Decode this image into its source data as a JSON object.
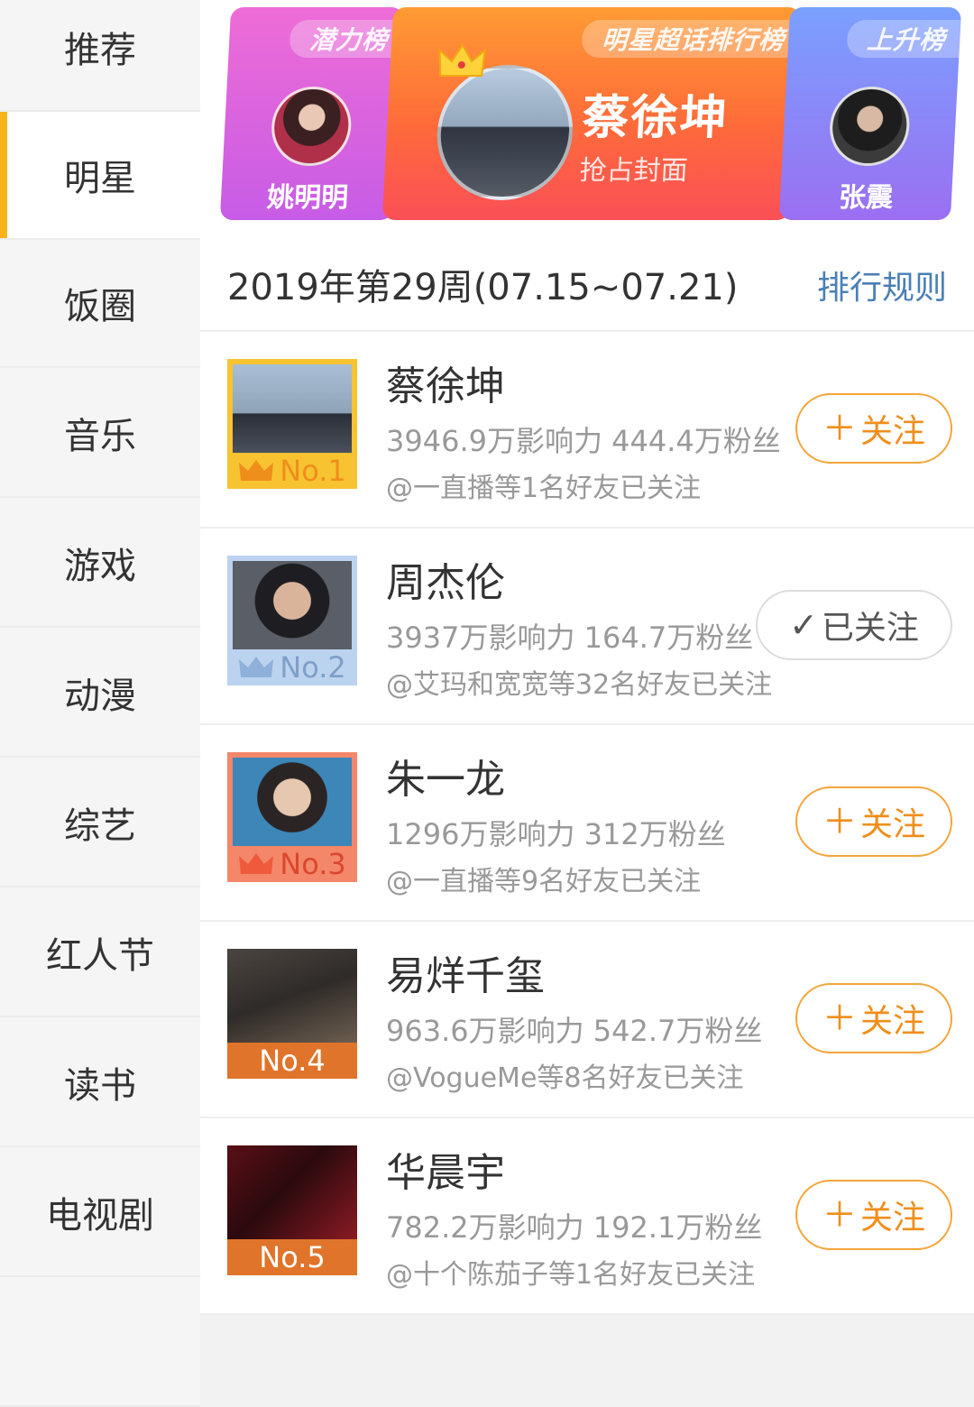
{
  "sidebar": {
    "items": [
      {
        "label": "推荐"
      },
      {
        "label": "明星"
      },
      {
        "label": "饭圈"
      },
      {
        "label": "音乐"
      },
      {
        "label": "游戏"
      },
      {
        "label": "动漫"
      },
      {
        "label": "综艺"
      },
      {
        "label": "红人节"
      },
      {
        "label": "读书"
      },
      {
        "label": "电视剧"
      }
    ],
    "active_index": 1,
    "active_color": "#f7b21c"
  },
  "banner": {
    "left": {
      "tag": "潜力榜",
      "name": "姚明明",
      "icon": "avatar"
    },
    "center": {
      "tag": "明星超话排行榜",
      "name": "蔡徐坤",
      "subtitle": "抢占封面",
      "icon": "crown-icon"
    },
    "right": {
      "tag": "上升榜",
      "name": "张震",
      "icon": "avatar"
    }
  },
  "week": {
    "title": "2019年第29周(07.15~07.21)",
    "rules_link": "排行规则"
  },
  "rankings": [
    {
      "rank": "No.1",
      "name": "蔡徐坤",
      "stats": "3946.9万影响力 444.4万粉丝",
      "friends": "@一直播等1名好友已关注",
      "button": "关注",
      "followed": false,
      "badge_color": "#f7c331"
    },
    {
      "rank": "No.2",
      "name": "周杰伦",
      "stats": "3937万影响力 164.7万粉丝",
      "friends": "@艾玛和宽宽等32名好友已关注",
      "button": "已关注",
      "followed": true,
      "badge_color": "#bcd3ef"
    },
    {
      "rank": "No.3",
      "name": "朱一龙",
      "stats": "1296万影响力 312万粉丝",
      "friends": "@一直播等9名好友已关注",
      "button": "关注",
      "followed": false,
      "badge_color": "#f4876a"
    },
    {
      "rank": "No.4",
      "name": "易烊千玺",
      "stats": "963.6万影响力 542.7万粉丝",
      "friends": "@VogueMe等8名好友已关注",
      "button": "关注",
      "followed": false,
      "badge_color": "#e0742a"
    },
    {
      "rank": "No.5",
      "name": "华晨宇",
      "stats": "782.2万影响力 192.1万粉丝",
      "friends": "@十个陈茄子等1名好友已关注",
      "button": "关注",
      "followed": false,
      "badge_color": "#e0742a"
    }
  ],
  "colors": {
    "accent": "#f08e1b",
    "link": "#4a7fb5"
  }
}
